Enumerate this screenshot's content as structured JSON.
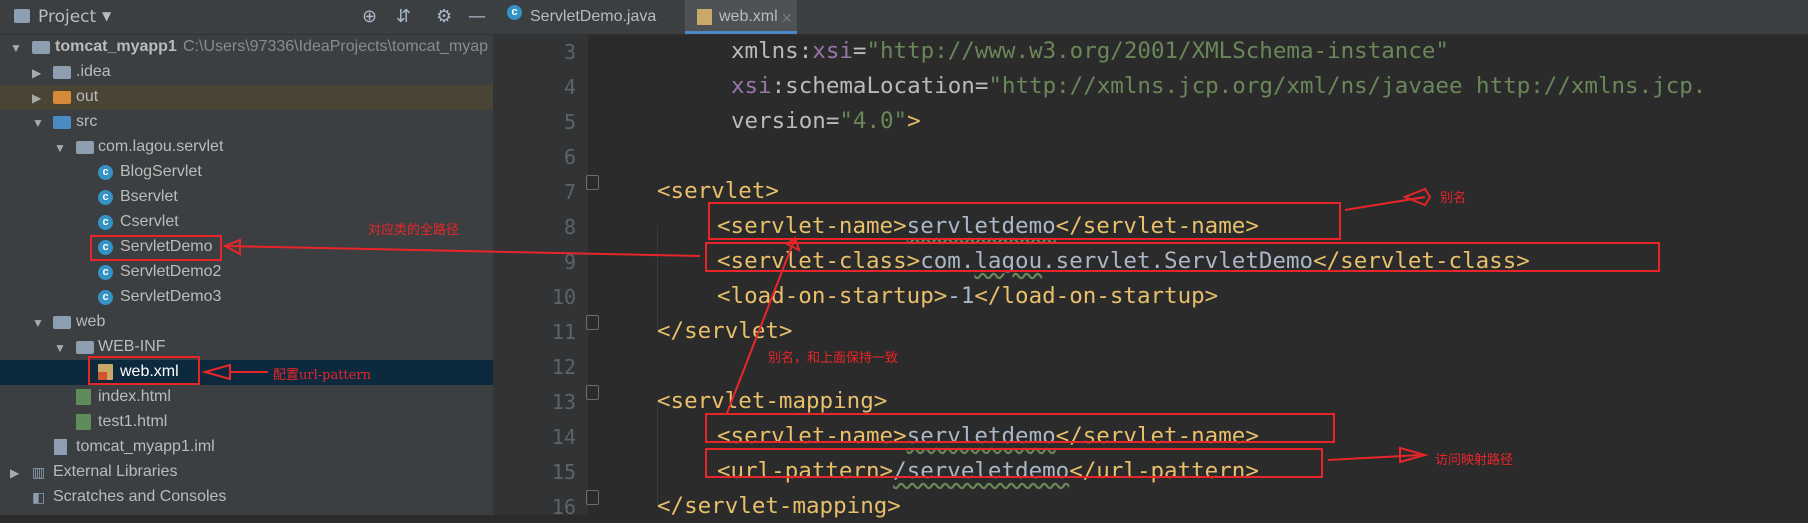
{
  "project_panel": {
    "title": "Project",
    "tree": [
      {
        "label": "tomcat_myapp1",
        "path": "C:\\Users\\97336\\IdeaProjects\\tomcat_myap"
      },
      {
        "label": ".idea"
      },
      {
        "label": "out"
      },
      {
        "label": "src"
      },
      {
        "label": "com.lagou.servlet"
      },
      {
        "label": "BlogServlet"
      },
      {
        "label": "Bservlet"
      },
      {
        "label": "Cservlet"
      },
      {
        "label": "ServletDemo"
      },
      {
        "label": "ServletDemo2"
      },
      {
        "label": "ServletDemo3"
      },
      {
        "label": "web"
      },
      {
        "label": "WEB-INF"
      },
      {
        "label": "web.xml"
      },
      {
        "label": "index.html"
      },
      {
        "label": "test1.html"
      },
      {
        "label": "tomcat_myapp1.iml"
      },
      {
        "label": "External Libraries"
      },
      {
        "label": "Scratches and Consoles"
      }
    ]
  },
  "tabs": [
    {
      "label": "ServletDemo.java",
      "icon": "class-icon"
    },
    {
      "label": "web.xml",
      "icon": "xml-file-icon",
      "active": true
    }
  ],
  "editor": {
    "line_numbers": [
      "3",
      "4",
      "5",
      "6",
      "7",
      "8",
      "9",
      "10",
      "11",
      "12",
      "13",
      "14",
      "15",
      "16"
    ],
    "lines": {
      "l3_a": "xmlns",
      "l3_b": ":",
      "l3_c": "xsi",
      "l3_d": "=",
      "l3_e": "\"http://www.w3.org/2001/XMLSchema-instance\"",
      "l4_a": "xsi",
      "l4_b": ":schemaLocation",
      "l4_c": "=",
      "l4_d": "\"http://xmlns.jcp.org/xml/ns/javaee http://xmlns.jcp.",
      "l5_a": "version",
      "l5_b": "=",
      "l5_c": "\"4.0\"",
      "l5_d": ">",
      "l7": "<servlet>",
      "l8_open": "<servlet-name>",
      "l8_text": "servletdemo",
      "l8_close": "</servlet-name>",
      "l9_open": "<servlet-class>",
      "l9_text_a": "com.",
      "l9_text_b": "lagou",
      "l9_text_c": ".servlet.ServletDemo",
      "l9_close": "</servlet-class>",
      "l10_open": "<load-on-startup>",
      "l10_text": "-1",
      "l10_close": "</load-on-startup>",
      "l11": "</servlet>",
      "l13": "<servlet-mapping>",
      "l14_open": "<servlet-name>",
      "l14_text": "servletdemo",
      "l14_close": "</servlet-name>",
      "l15_open": "<url-pattern>",
      "l15_text": "/serveletdemo",
      "l15_close": "</url-pattern>",
      "l16": "</servlet-mapping>"
    }
  },
  "annotations": {
    "alias": "别名",
    "full_path": "对应类的全路径",
    "config_url": "配置url-pattern",
    "alias_same": "别名，和上面保持一致",
    "access_path": "访问映射路径"
  },
  "colors": {
    "annotation": "#e8262a",
    "tag": "#e8bf6a",
    "string": "#6a8759",
    "namespace": "#9876aa"
  }
}
